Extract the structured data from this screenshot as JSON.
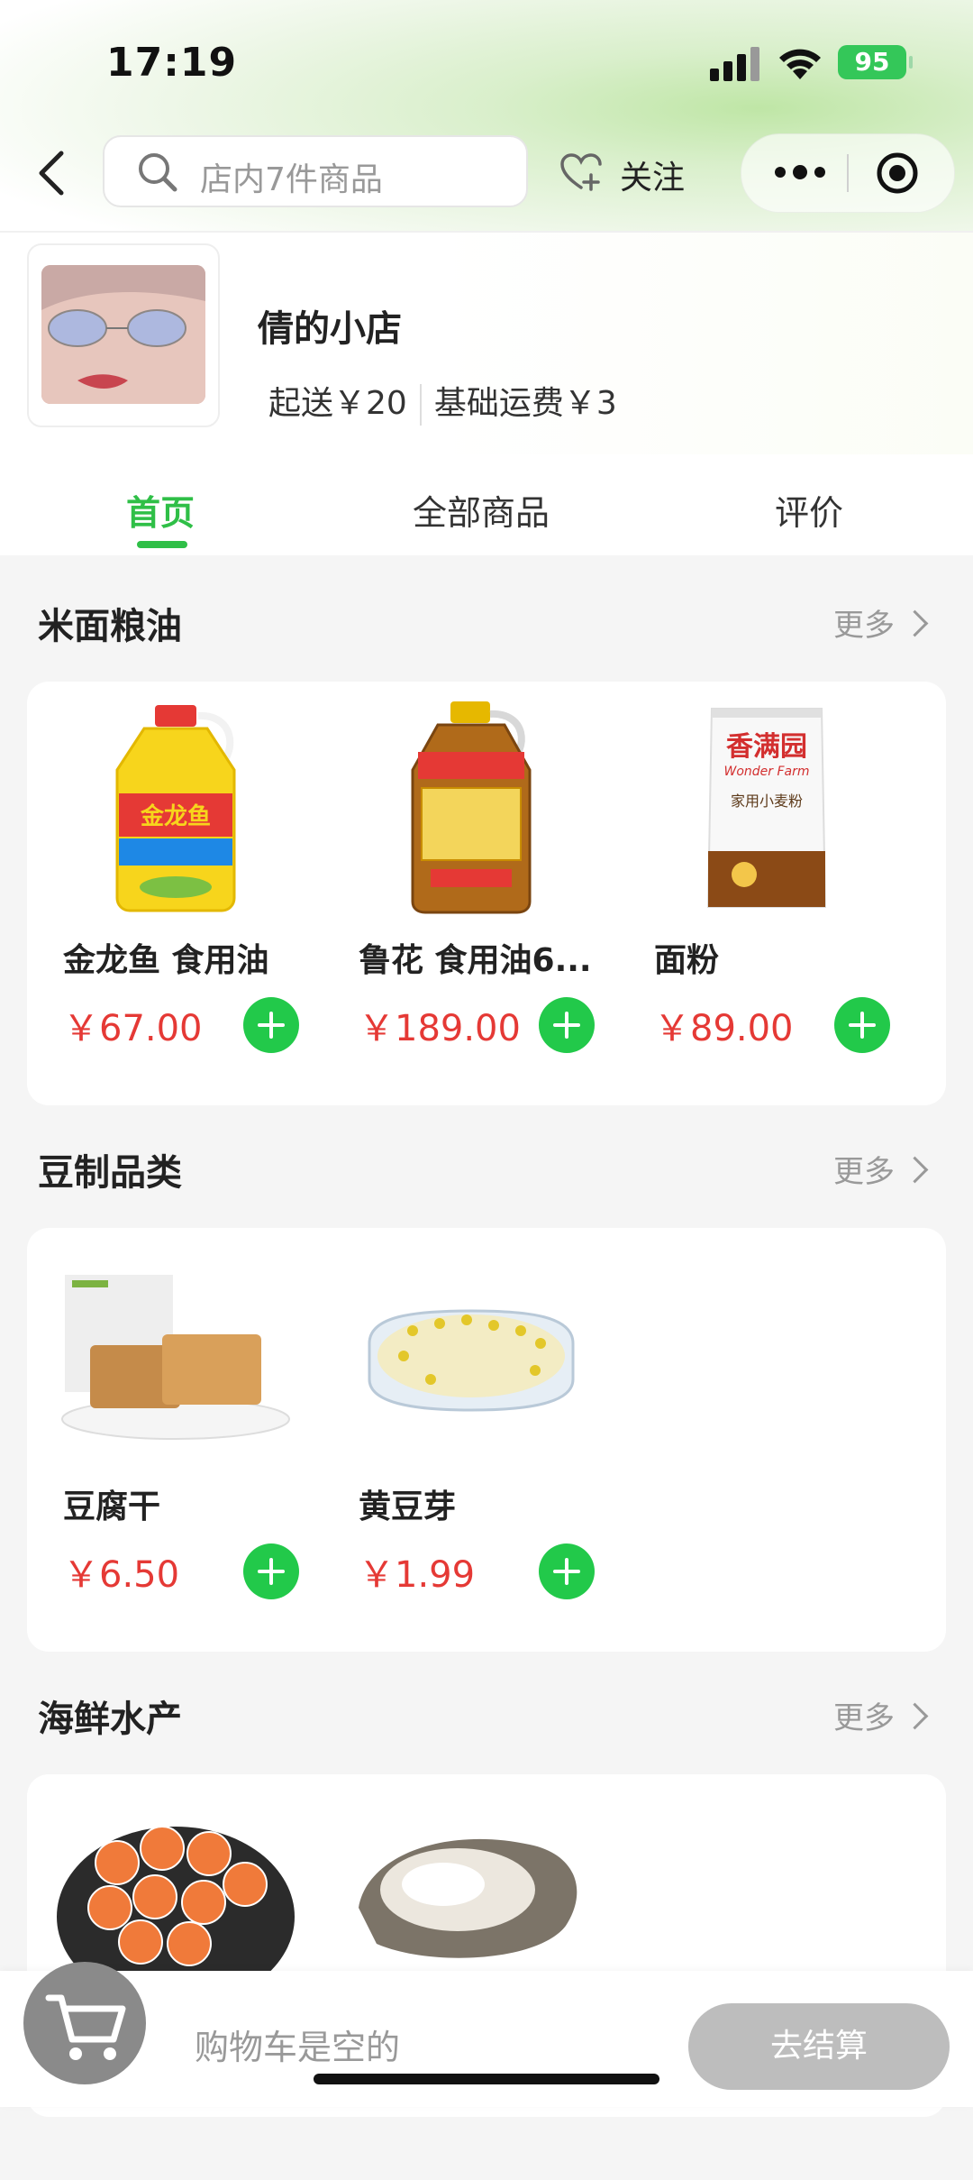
{
  "status_bar": {
    "time": "17:19",
    "battery": "95"
  },
  "nav": {
    "search_placeholder": "店内7件商品",
    "follow_label": "关注"
  },
  "shop": {
    "name": "倩的小店",
    "min_order": "起送￥20",
    "base_fee": "基础运费￥3"
  },
  "tabs": [
    {
      "label": "首页",
      "active": true
    },
    {
      "label": "全部商品",
      "active": false
    },
    {
      "label": "评价",
      "active": false
    }
  ],
  "sections": [
    {
      "title": "米面粮油",
      "more": "更多",
      "items": [
        {
          "name": "金龙鱼 食用油",
          "price": "￥67.00",
          "image": "yellow-oil-bottle"
        },
        {
          "name": "鲁花 食用油6...",
          "price": "￥189.00",
          "image": "brown-oil-bottle"
        },
        {
          "name": "面粉",
          "price": "￥89.00",
          "image": "flour-bag"
        }
      ]
    },
    {
      "title": "豆制品类",
      "more": "更多",
      "items": [
        {
          "name": "豆腐干",
          "price": "￥6.50",
          "image": "dried-tofu-plate"
        },
        {
          "name": "黄豆芽",
          "price": "￥1.99",
          "image": "bean-sprouts-plate"
        }
      ]
    },
    {
      "title": "海鲜水产",
      "more": "更多",
      "items": [
        {
          "image": "shrimp-bowl"
        },
        {
          "image": "oyster"
        }
      ]
    }
  ],
  "product_images": {
    "yellow_oil_brand": "金龙鱼",
    "flour_brand": "香满园",
    "flour_brand_en": "Wonder Farm",
    "flour_subtitle": "家用小麦粉"
  },
  "cart": {
    "empty_text": "购物车是空的",
    "checkout_label": "去结算"
  },
  "colors": {
    "accent": "#2fbf47",
    "price": "#e53935",
    "add_button": "#22c94a"
  }
}
